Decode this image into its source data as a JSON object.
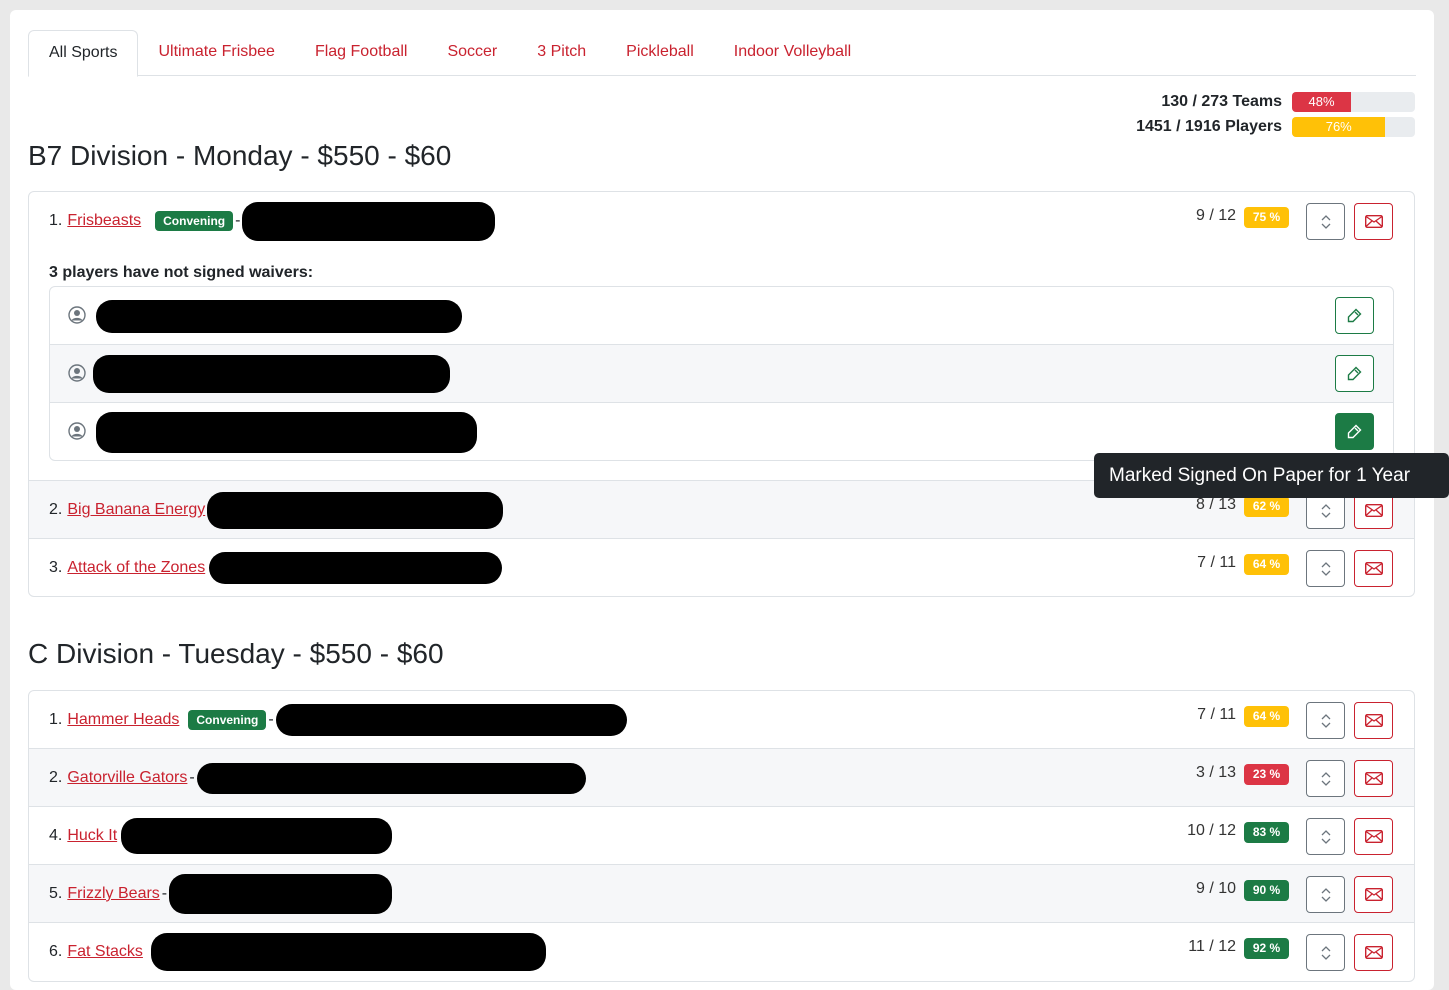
{
  "tabs": [
    "All Sports",
    "Ultimate Frisbee",
    "Flag Football",
    "Soccer",
    "3 Pitch",
    "Pickleball",
    "Indoor Volleyball"
  ],
  "stats": {
    "teams_label": "130 / 273 Teams",
    "teams_pct_label": "48%",
    "teams_pct": 48,
    "players_label": "1451 / 1916 Players",
    "players_pct_label": "76%",
    "players_pct": 76
  },
  "colors": {
    "red": "#dc3545",
    "yellow": "#ffc107",
    "green": "#1c7b45",
    "brand": "#c9222f"
  },
  "divisions": [
    {
      "title": "B7 Division - Monday - $550 - $60",
      "teams": [
        {
          "index": "1.",
          "name": "Frisbeasts",
          "badge": "Convening",
          "count": "9 / 12",
          "pct": "75 %",
          "pct_color": "yellow",
          "waiver_heading": "3 players have not signed waivers:"
        },
        {
          "index": "2.",
          "name": "Big Banana Energy",
          "count": "8 / 13",
          "pct": "62 %",
          "pct_color": "yellow"
        },
        {
          "index": "3.",
          "name": "Attack of the Zones",
          "count": "7 / 11",
          "pct": "64 %",
          "pct_color": "yellow"
        }
      ]
    },
    {
      "title": "C Division - Tuesday - $550 - $60",
      "teams": [
        {
          "index": "1.",
          "name": "Hammer Heads ",
          "badge": "Convening",
          "count": "7 / 11",
          "pct": "64 %",
          "pct_color": "yellow"
        },
        {
          "index": "2.",
          "name": "Gatorville Gators",
          "count": "3 / 13",
          "pct": "23 %",
          "pct_color": "red"
        },
        {
          "index": "4.",
          "name": "Huck It",
          "count": "10 / 12",
          "pct": "83 %",
          "pct_color": "green"
        },
        {
          "index": "5.",
          "name": "Frizzly Bears",
          "count": "9 / 10",
          "pct": "90 %",
          "pct_color": "green"
        },
        {
          "index": "6.",
          "name": "Fat Stacks",
          "count": "11 / 12",
          "pct": "92 %",
          "pct_color": "green"
        }
      ]
    }
  ],
  "tooltip": "Marked Signed On Paper for 1 Year",
  "icons": {
    "sort": "sort-icon",
    "mail": "envelope-icon",
    "sign": "pen-icon",
    "person": "person-circle-icon"
  }
}
